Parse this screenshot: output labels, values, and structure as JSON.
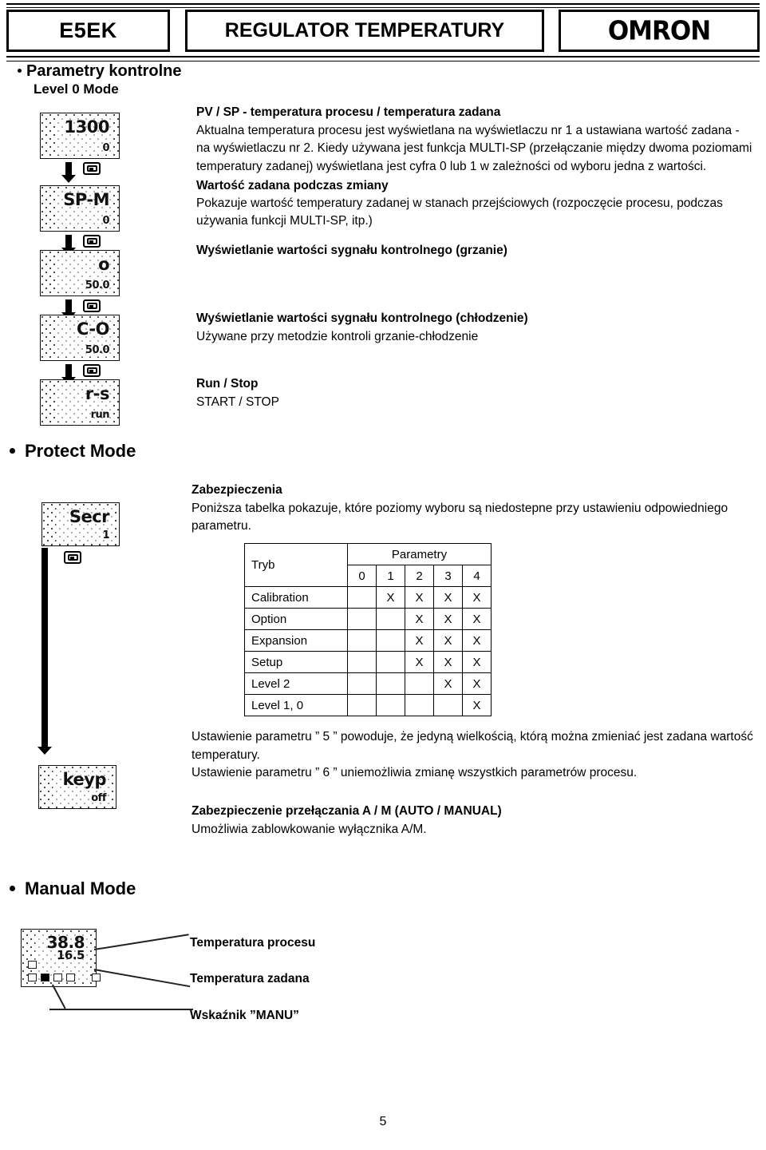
{
  "header": {
    "model": "E5EK",
    "title": "REGULATOR TEMPERATURY",
    "brand": "OMRON"
  },
  "section_level0": {
    "heading": "Parametry kontrolne",
    "subheading": "Level 0 Mode",
    "displays": [
      {
        "name": "pv-sp-display",
        "line1": "1300",
        "line2": "0"
      },
      {
        "name": "sp-m-display",
        "line1": "SP-M",
        "line2": "0"
      },
      {
        "name": "mv-heat-display",
        "line1": "o",
        "line2": "50.0"
      },
      {
        "name": "mv-cool-display",
        "line1": "C-O",
        "line2": "50.0"
      },
      {
        "name": "run-stop-display",
        "line1": "r-s",
        "line2": "run"
      }
    ],
    "blocks": [
      {
        "title": "PV / SP - temperatura procesu / temperatura zadana",
        "body": "Aktualna temperatura procesu jest wyświetlana na wyświetlaczu nr 1 a ustawiana wartość zadana - na wyświetlaczu nr 2. Kiedy używana jest funkcja MULTI-SP (przełączanie między dwoma poziomami temperatury zadanej) wyświetlana jest cyfra 0 lub 1 w zależności od wyboru jedna z wartości."
      },
      {
        "title": "Wartość zadana podczas zmiany",
        "body": "Pokazuje wartość temperatury zadanej w stanach przejściowych (rozpoczęcie procesu, podczas używania funkcji MULTI-SP, itp.)"
      },
      {
        "title": "Wyświetlanie wartości sygnału kontrolnego (grzanie)",
        "body": ""
      },
      {
        "title": "Wyświetlanie wartości sygnału kontrolnego (chłodzenie)",
        "body": "Używane przy metodzie kontroli grzanie-chłodzenie"
      },
      {
        "title": "Run / Stop",
        "body": "START / STOP"
      }
    ]
  },
  "section_protect": {
    "heading": "Protect Mode",
    "displays": [
      {
        "name": "secr-display",
        "line1": "Secr",
        "line2": "1"
      },
      {
        "name": "keyp-display",
        "line1": "keyp",
        "line2": "off"
      }
    ],
    "intro_title": "Zabezpieczenia",
    "intro_body": "Poniższa tabelka pokazuje, które poziomy wyboru są niedostepne przy ustawieniu odpowiedniego parametru.",
    "table": {
      "mode_header": "Tryb",
      "group_header": "Parametry",
      "param_columns": [
        "0",
        "1",
        "2",
        "3",
        "4"
      ],
      "rows": [
        {
          "label": "Calibration",
          "marks": [
            "",
            "X",
            "X",
            "X",
            "X"
          ]
        },
        {
          "label": "Option",
          "marks": [
            "",
            "",
            "X",
            "X",
            "X"
          ]
        },
        {
          "label": "Expansion",
          "marks": [
            "",
            "",
            "X",
            "X",
            "X"
          ]
        },
        {
          "label": "Setup",
          "marks": [
            "",
            "",
            "X",
            "X",
            "X"
          ]
        },
        {
          "label": "Level 2",
          "marks": [
            "",
            "",
            "",
            "X",
            "X"
          ]
        },
        {
          "label": "Level 1, 0",
          "marks": [
            "",
            "",
            "",
            "",
            "X"
          ]
        }
      ],
      "mark_symbol": "X"
    },
    "note_line1": "Ustawienie parametru ” 5 ” powoduje, że jedyną wielkością, którą można zmieniać jest zadana wartość",
    "note_line2": "temperatury.",
    "note_line3": "Ustawienie parametru ” 6 ” uniemożliwia zmianę wszystkich parametrów procesu.",
    "am_title": "Zabezpieczenie przełączania A / M  (AUTO / MANUAL)",
    "am_body": "Umożliwia zablowkowanie wyłącznika A/M."
  },
  "section_manual": {
    "heading": "Manual Mode",
    "display": {
      "name": "manual-display",
      "line1": "38.8",
      "line2": "16.5"
    },
    "callouts": [
      "Temperatura procesu",
      "Temperatura zadana",
      "Wskaźnik ”MANU”"
    ]
  },
  "footer": {
    "page_number": "5"
  },
  "icons": {
    "mode_key": "mode-key-icon"
  },
  "colors": {
    "ink": "#000000",
    "paper": "#ffffff",
    "lcd_dot": "#4a4a4a"
  }
}
